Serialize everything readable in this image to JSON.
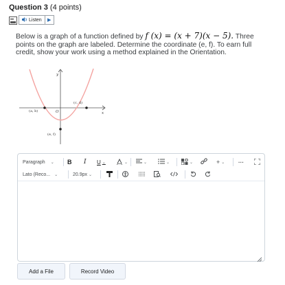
{
  "question": {
    "title": "Question 3",
    "points": "(4 points)"
  },
  "listen": {
    "label": "Listen",
    "speaker_icon": "speaker-icon",
    "play_icon": "play-icon"
  },
  "prompt": {
    "text_before": "Below is a graph of a function defined by ",
    "formula": "f (x) = (x + 7)(x − 5).",
    "text_after": " Three points on the graph are labeled. Determine the coordinate (e, f). To earn full credit, show your work using a method explained in the Orientation."
  },
  "graph": {
    "labels": {
      "y": "y",
      "x": "x",
      "origin": "O",
      "cd": "(c, d)",
      "ab": "(a, b)",
      "ef": "(e, f)"
    },
    "curve_color": "#f4a3a0",
    "point_color": "#222222"
  },
  "toolbar": {
    "paragraph": "Paragraph",
    "bold": "B",
    "italic": "I",
    "underline": "U",
    "font": "Lato (Reco...",
    "size": "20.9px",
    "more": "···",
    "add_label": "+"
  },
  "buttons": {
    "add_file": "Add a File",
    "record_video": "Record Video"
  }
}
